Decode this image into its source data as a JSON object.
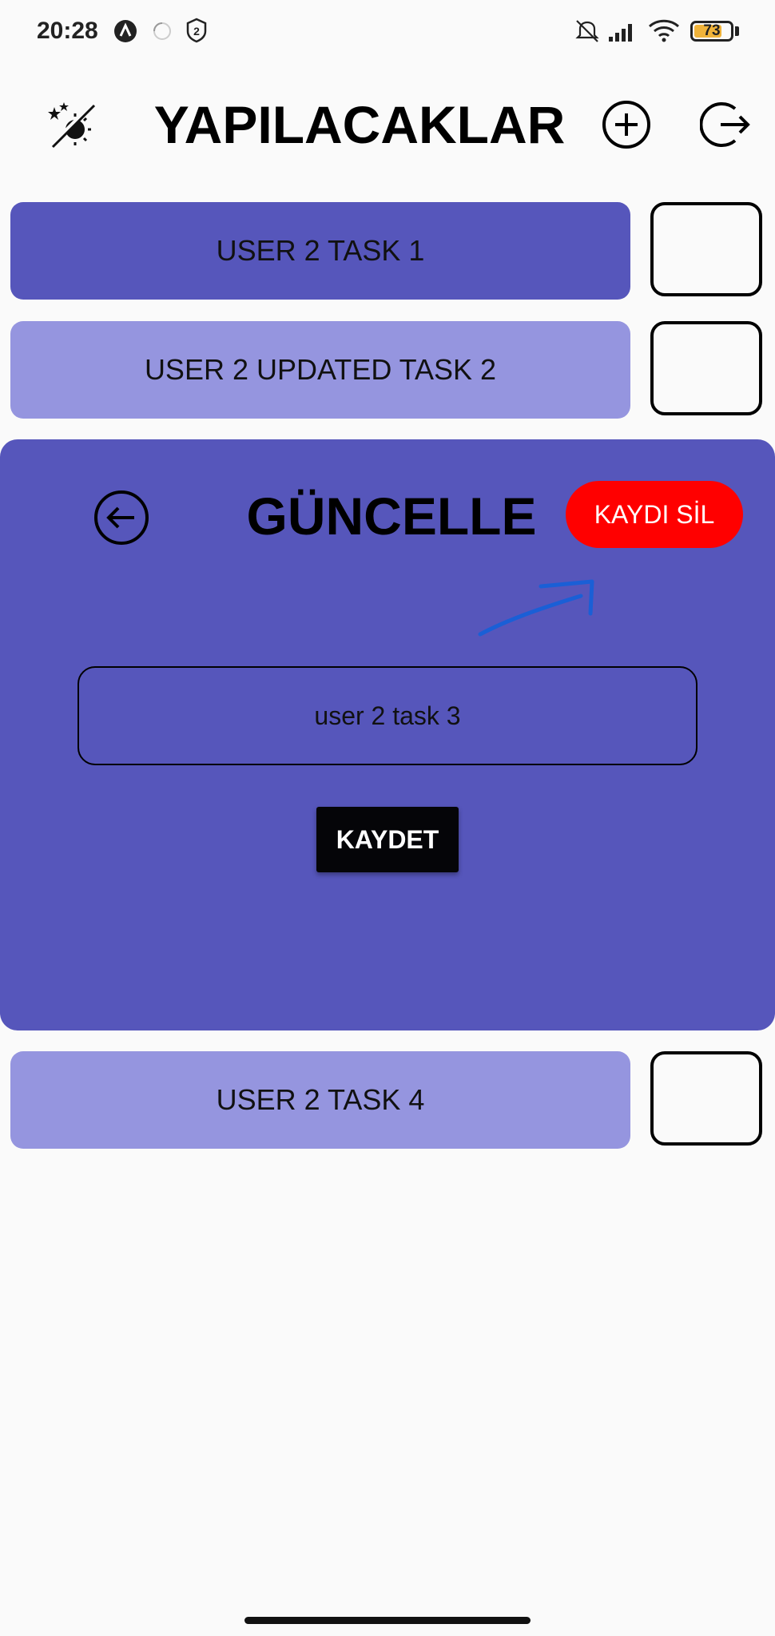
{
  "status_bar": {
    "time": "20:28",
    "battery": "73",
    "icons": [
      "a-badge-icon",
      "loading-circle-icon",
      "shield-2-icon",
      "mute-icon",
      "signal-icon",
      "wifi-icon",
      "battery-icon"
    ]
  },
  "header": {
    "title": "YAPILACAKLAR",
    "left_icon": "theme-toggle-icon",
    "right_icons": [
      "add-circle-icon",
      "logout-icon"
    ]
  },
  "tasks": [
    {
      "label": "USER 2 TASK 1",
      "color": "#5656bb"
    },
    {
      "label": "USER 2 UPDATED TASK 2",
      "color": "#9595df"
    },
    {
      "label": "USER 2 TASK 4",
      "color": "#9595df"
    }
  ],
  "update_panel": {
    "title": "GÜNCELLE",
    "delete_label": "KAYDI SİL",
    "input_value": "user 2 task 3",
    "save_label": "KAYDET",
    "background": "#5656bb",
    "delete_color": "#ff0000"
  }
}
